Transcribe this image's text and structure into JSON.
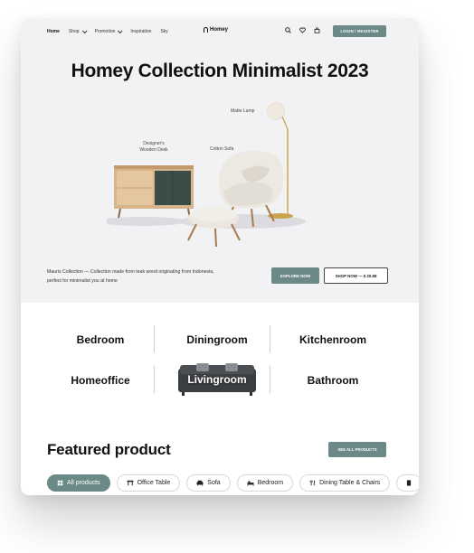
{
  "nav": {
    "items": [
      {
        "label": "Home"
      },
      {
        "label": "Shop"
      },
      {
        "label": "Promotion"
      },
      {
        "label": "Inspiration"
      },
      {
        "label": "Sky"
      }
    ],
    "logo_text": "Homey",
    "login_label": "LOGIN / REGISTER"
  },
  "hero": {
    "title": "Homey Collection Minimalist 2023",
    "labels": {
      "lamp": "Matte Lamp",
      "desk": "Designer's\nWooden Desk",
      "sofa": "Cotton Sofa"
    },
    "description": "Mauris Collection — Collection made from teak wood originating from Indonesia, perfect for minimalist you at home",
    "explore_label": "EXPLORE NOW",
    "shop_label": "SHOP NOW — $ 20.88"
  },
  "categories": [
    "Bedroom",
    "Diningroom",
    "Kitchenroom",
    "Homeoffice",
    "Livingroom",
    "Bathroom"
  ],
  "featured": {
    "title": "Featured product",
    "see_all_label": "SEE ALL PRODUCTS"
  },
  "filters": [
    {
      "label": "All products",
      "icon": "grid-icon",
      "active": true
    },
    {
      "label": "Office Table",
      "icon": "table-icon",
      "active": false
    },
    {
      "label": "Sofa",
      "icon": "sofa-icon",
      "active": false
    },
    {
      "label": "Bedroom",
      "icon": "bed-icon",
      "active": false
    },
    {
      "label": "Dining Table & Chairs",
      "icon": "dining-icon",
      "active": false
    }
  ],
  "colors": {
    "accent": "#6b8a87",
    "hero_bg": "#f2f2f4"
  }
}
